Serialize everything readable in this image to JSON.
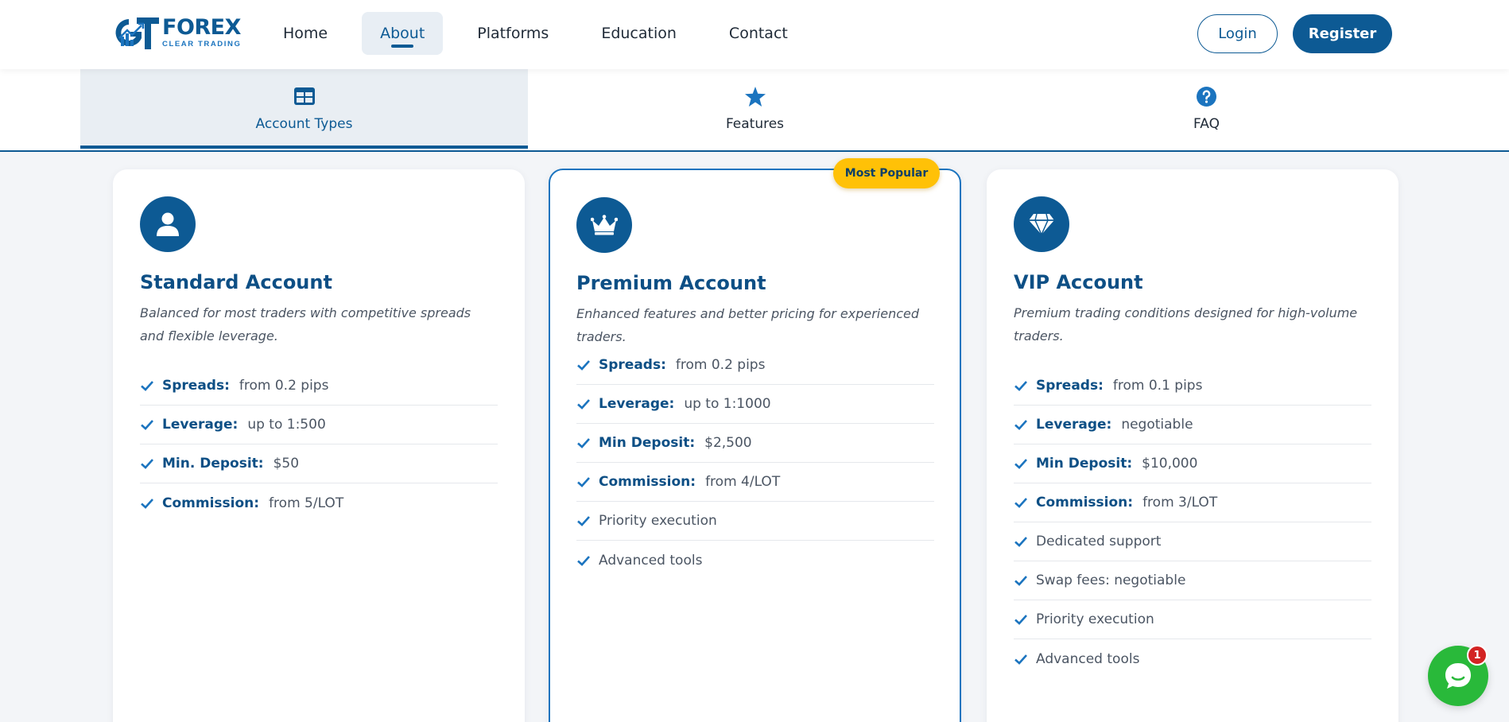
{
  "brand": {
    "name": "FOREX",
    "tagline": "CLEAR TRADING",
    "logo_mark_letters": "GT",
    "primary_color": "#0d5a94",
    "accent_color": "#ffc107"
  },
  "nav": {
    "items": [
      {
        "label": "Home",
        "active": false
      },
      {
        "label": "About",
        "active": true
      },
      {
        "label": "Platforms",
        "active": false
      },
      {
        "label": "Education",
        "active": false
      },
      {
        "label": "Contact",
        "active": false
      }
    ],
    "login_label": "Login",
    "register_label": "Register"
  },
  "tabs": [
    {
      "label": "Account Types",
      "icon": "table-icon",
      "active": true
    },
    {
      "label": "Features",
      "icon": "star-icon",
      "active": false
    },
    {
      "label": "FAQ",
      "icon": "question-circle-icon",
      "active": false
    }
  ],
  "cards": [
    {
      "icon": "user-icon",
      "title": "Standard Account",
      "description": "Balanced for most traders with competitive spreads and flexible leverage.",
      "features": [
        {
          "label": "Spreads:",
          "value": "from 0.2 pips"
        },
        {
          "label": "Leverage:",
          "value": "up to 1:500"
        },
        {
          "label": "Min. Deposit:",
          "value": "$50"
        },
        {
          "label": "Commission:",
          "value": "from 5/LOT"
        }
      ]
    },
    {
      "icon": "crown-icon",
      "badge": "Most Popular",
      "title": "Premium Account",
      "description": "Enhanced features and better pricing for experienced traders.",
      "features": [
        {
          "label": "Spreads:",
          "value": "from 0.2 pips"
        },
        {
          "label": "Leverage:",
          "value": "up to 1:1000"
        },
        {
          "label": "Min Deposit:",
          "value": "$2,500"
        },
        {
          "label": "Commission:",
          "value": "from 4/LOT"
        },
        {
          "text": "Priority execution"
        },
        {
          "text": "Advanced tools"
        }
      ]
    },
    {
      "icon": "diamond-icon",
      "title": "VIP Account",
      "description": "Premium trading conditions designed for high-volume traders.",
      "features": [
        {
          "label": "Spreads:",
          "value": "from 0.1 pips"
        },
        {
          "label": "Leverage:",
          "value": "negotiable"
        },
        {
          "label": "Min Deposit:",
          "value": "$10,000"
        },
        {
          "label": "Commission:",
          "value": "from 3/LOT"
        },
        {
          "text": "Dedicated support"
        },
        {
          "text": "Swap fees: negotiable"
        },
        {
          "text": "Priority execution"
        },
        {
          "text": "Advanced tools"
        }
      ]
    }
  ],
  "chat": {
    "icon": "chat-bubble-icon",
    "unread_count": "1"
  }
}
